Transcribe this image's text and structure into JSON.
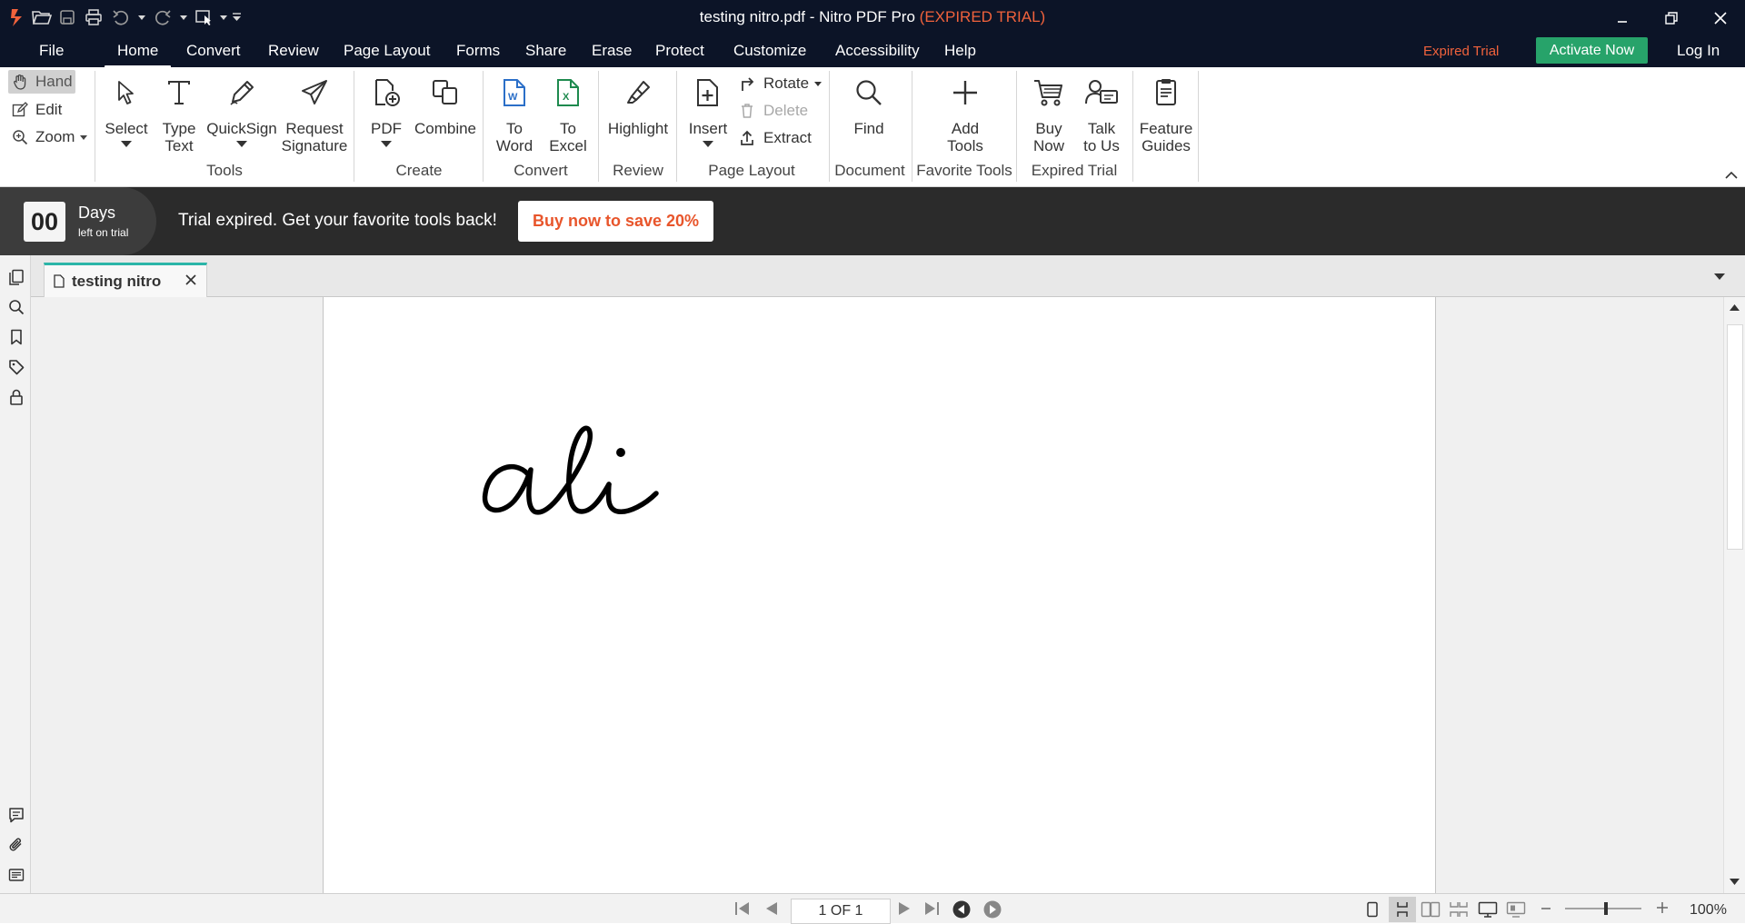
{
  "window": {
    "title_main": "testing nitro.pdf - Nitro PDF Pro ",
    "title_status": "(EXPIRED TRIAL)"
  },
  "menu": {
    "items": [
      "File",
      "Home",
      "Convert",
      "Review",
      "Page Layout",
      "Forms",
      "Share",
      "Erase",
      "Protect",
      "Customize",
      "Accessibility",
      "Help"
    ],
    "active": "Home",
    "expired_trial": "Expired Trial",
    "activate_now": "Activate Now",
    "log_in": "Log In"
  },
  "ribbon": {
    "modes": {
      "hand": "Hand",
      "edit": "Edit",
      "zoom": "Zoom"
    },
    "tools": {
      "select": "Select",
      "type_text_1": "Type",
      "type_text_2": "Text",
      "quicksign": "QuickSign",
      "request_sig_1": "Request",
      "request_sig_2": "Signature",
      "group": "Tools"
    },
    "create": {
      "pdf": "PDF",
      "combine": "Combine",
      "group": "Create"
    },
    "convert": {
      "to_word_1": "To",
      "to_word_2": "Word",
      "to_excel_1": "To",
      "to_excel_2": "Excel",
      "group": "Convert"
    },
    "review": {
      "highlight": "Highlight",
      "group": "Review"
    },
    "page_layout": {
      "insert": "Insert",
      "rotate": "Rotate",
      "delete": "Delete",
      "extract": "Extract",
      "group": "Page Layout"
    },
    "document": {
      "find": "Find",
      "group": "Document"
    },
    "favorite": {
      "add_tools_1": "Add",
      "add_tools_2": "Tools",
      "group": "Favorite Tools"
    },
    "expired": {
      "buy_now_1": "Buy",
      "buy_now_2": "Now",
      "talk_1": "Talk",
      "talk_2": "to Us",
      "group": "Expired Trial"
    },
    "guides": {
      "feature_1": "Feature",
      "feature_2": "Guides"
    }
  },
  "banner": {
    "days_count": "00",
    "days_label": "Days",
    "days_sub": "left on trial",
    "message": "Trial expired. Get your favorite tools back!",
    "cta": "Buy now to save 20%"
  },
  "tabs": [
    {
      "label": "testing nitro"
    }
  ],
  "status": {
    "page_indicator": "1 OF 1",
    "zoom": "100%"
  },
  "colors": {
    "titlebar_bg": "#0c1427",
    "expired_accent": "#f0623c",
    "activate_green": "#27a36a",
    "tab_accent": "#2bb5a8",
    "banner_bg": "#2b2b2b"
  }
}
